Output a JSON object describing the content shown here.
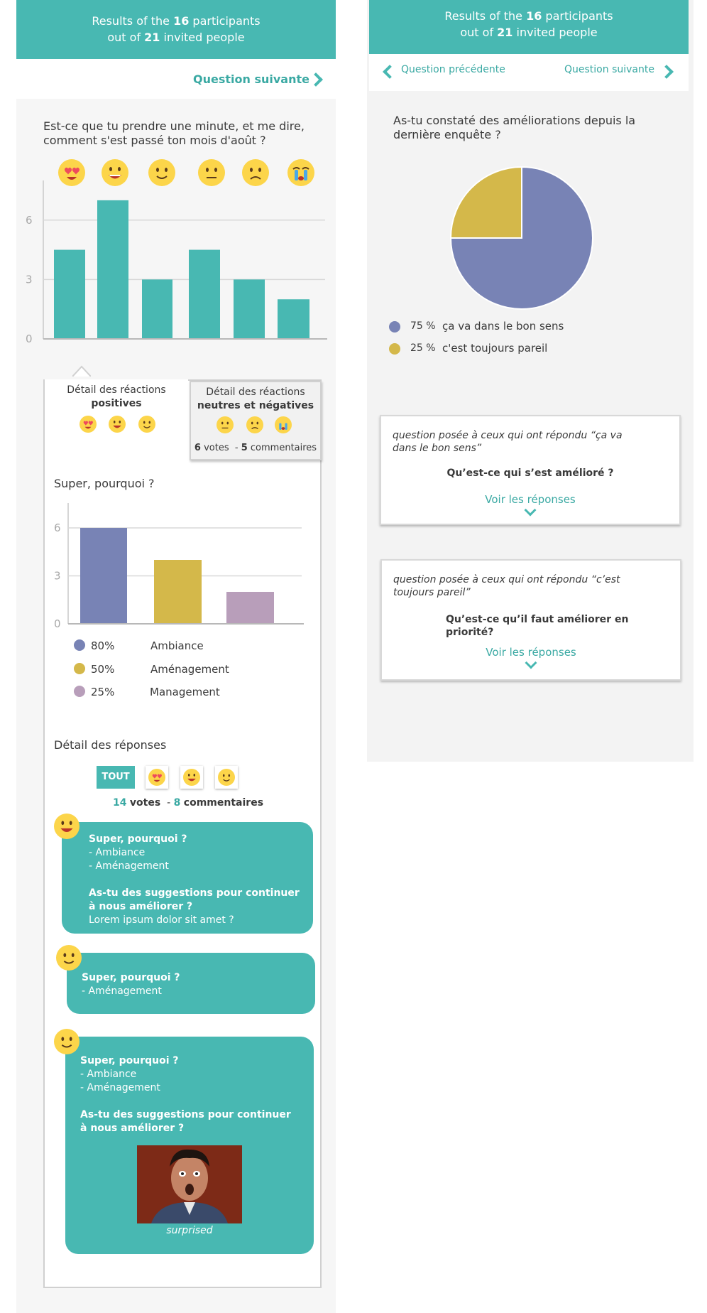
{
  "left_panel": {
    "header": {
      "line1_prefix": "Results of the",
      "participants": "16",
      "line1_suffix": "participants",
      "line2_prefix": "out of",
      "invited": "21",
      "line2_suffix": "invited people"
    },
    "nav": {
      "next_label": "Question suivante"
    },
    "question": {
      "title_line1": "Est-ce que tu prendre une minute, et me dire,",
      "title_line2": "comment s'est passé ton mois d'août ?",
      "emoji_scale": [
        "heart-eyes-icon",
        "grin-icon",
        "smile-icon",
        "neutral-face-icon",
        "sad-face-icon",
        "crying-face-icon"
      ]
    },
    "chart_data": {
      "type": "bar",
      "categories": [
        "heart-eyes",
        "grin",
        "smile",
        "neutral",
        "sad",
        "crying"
      ],
      "values": [
        4.5,
        7,
        3,
        4.5,
        3,
        2
      ],
      "ticks": [
        "0",
        "3",
        "6"
      ],
      "ylim": [
        0,
        8
      ],
      "color": "#48b8b2"
    },
    "tabs": {
      "positive": {
        "line1": "Détail des réactions",
        "line2": "positives"
      },
      "negative": {
        "line1": "Détail des réactions",
        "line2": "neutres et négatives",
        "votes_count": "6",
        "votes_label": "votes",
        "sep": "-",
        "comments_count": "5",
        "comments_label": "commentaires"
      }
    },
    "sub_question": {
      "title": "Super, pourquoi ?",
      "chart_data": {
        "type": "bar",
        "categories": [
          "Ambiance",
          "Aménagement",
          "Management"
        ],
        "values": [
          6,
          4,
          2
        ],
        "ticks": [
          "0",
          "3",
          "6"
        ],
        "ylim": [
          0,
          6.5
        ],
        "colors": [
          "#7883b5",
          "#d4b84a",
          "#b89eba"
        ]
      },
      "legend": [
        {
          "pct": "80%",
          "label": "Ambiance",
          "color": "#7883b5"
        },
        {
          "pct": "50%",
          "label": "Aménagement",
          "color": "#d4b84a"
        },
        {
          "pct": "25%",
          "label": "Management",
          "color": "#b89eba"
        }
      ]
    },
    "responses": {
      "title": "Détail des réponses",
      "filter_all": "TOUT",
      "votes_count": "14",
      "votes_label": "votes",
      "sep": "-",
      "comments_count": "8",
      "comments_label": "commentaires",
      "items": [
        {
          "q1": "Super, pourquoi ?",
          "a1": "- Ambiance",
          "a2": "- Aménagement",
          "q2_line1": "As-tu des suggestions pour continuer",
          "q2_line2": "à nous améliorer ?",
          "a3": "Lorem ipsum dolor sit amet ?"
        },
        {
          "q1": "Super, pourquoi ?",
          "a1": "- Aménagement"
        },
        {
          "q1": "Super, pourquoi ?",
          "a1": "- Ambiance",
          "a2": "- Aménagement",
          "q2_line1": "As-tu des suggestions pour continuer",
          "q2_line2": "à nous améliorer ?",
          "gif_caption": "surprised"
        }
      ]
    }
  },
  "right_panel": {
    "header": {
      "line1_prefix": "Results of the",
      "participants": "16",
      "line1_suffix": "participants",
      "line2_prefix": "out of",
      "invited": "21",
      "line2_suffix": "invited people"
    },
    "nav": {
      "prev_label": "Question précédente",
      "next_label": "Question suivante"
    },
    "question": {
      "title_line1": "As-tu constaté des améliorations depuis la",
      "title_line2": "dernière enquête ?"
    },
    "chart_data": {
      "type": "pie",
      "labels": [
        "ça va dans le bon sens",
        "c'est toujours pareil"
      ],
      "values": [
        75,
        25
      ],
      "colors": [
        "#7883b5",
        "#d4b84a"
      ]
    },
    "legend": [
      {
        "pct": "75 %",
        "label": "ça va dans le bon sens",
        "color": "#7883b5"
      },
      {
        "pct": "25 %",
        "label": "c'est toujours pareil",
        "color": "#d4b84a"
      }
    ],
    "cards": [
      {
        "note_line1": "question posée à ceux qui ont répondu “ça va",
        "note_line2": "dans le bon sens”",
        "question_line1": "Qu’est-ce qui s’est amélioré ?",
        "question_line2": "",
        "link": "Voir les réponses"
      },
      {
        "note_line1": "question posée à ceux qui ont répondu “c’est",
        "note_line2": "toujours pareil”",
        "question_line1": "Qu’est-ce qu’il faut améliorer en",
        "question_line2": "priorité?",
        "link": "Voir les réponses"
      }
    ]
  }
}
